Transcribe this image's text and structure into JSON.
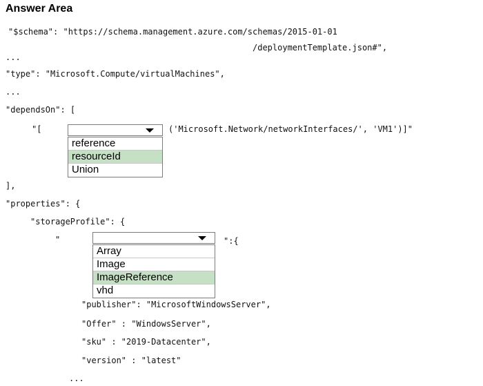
{
  "title": "Answer Area",
  "lines": {
    "schema1": "\"$schema\": \"https://schema.management.azure.com/schemas/2015-01-01",
    "schema2": "/deploymentTemplate.json#\",",
    "dots1": "...",
    "type": "\"type\": \"Microsoft.Compute/virtualMachines\",",
    "dots2": "...",
    "dependsOn": "\"dependsOn\": [",
    "dep_prefix": "\"[",
    "dep_suffix": "('Microsoft.Network/networkInterfaces/', 'VM1')]\"",
    "close_bracket": "],",
    "properties": "\"properties\": {",
    "storageProfile": "\"storageProfile\": {",
    "sp_prefix": "\"",
    "sp_suffix": "\":{",
    "publisher": "\"publisher\": \"MicrosoftWindowsServer\",",
    "offer": "\"Offer\" : \"WindowsServer\",",
    "sku": "\"sku\" : \"2019-Datacenter\",",
    "version": "\"version\" : \"latest\"",
    "dots3": "..."
  },
  "dropdown1": {
    "options": [
      "reference",
      "resourceId",
      "Union"
    ],
    "selected": "resourceId"
  },
  "dropdown2": {
    "options": [
      "Array",
      "Image",
      "ImageReference",
      "vhd"
    ],
    "selected": "ImageReference"
  },
  "colors": {
    "selected_bg": "#c6e0c6",
    "border": "#7a7a7a"
  }
}
